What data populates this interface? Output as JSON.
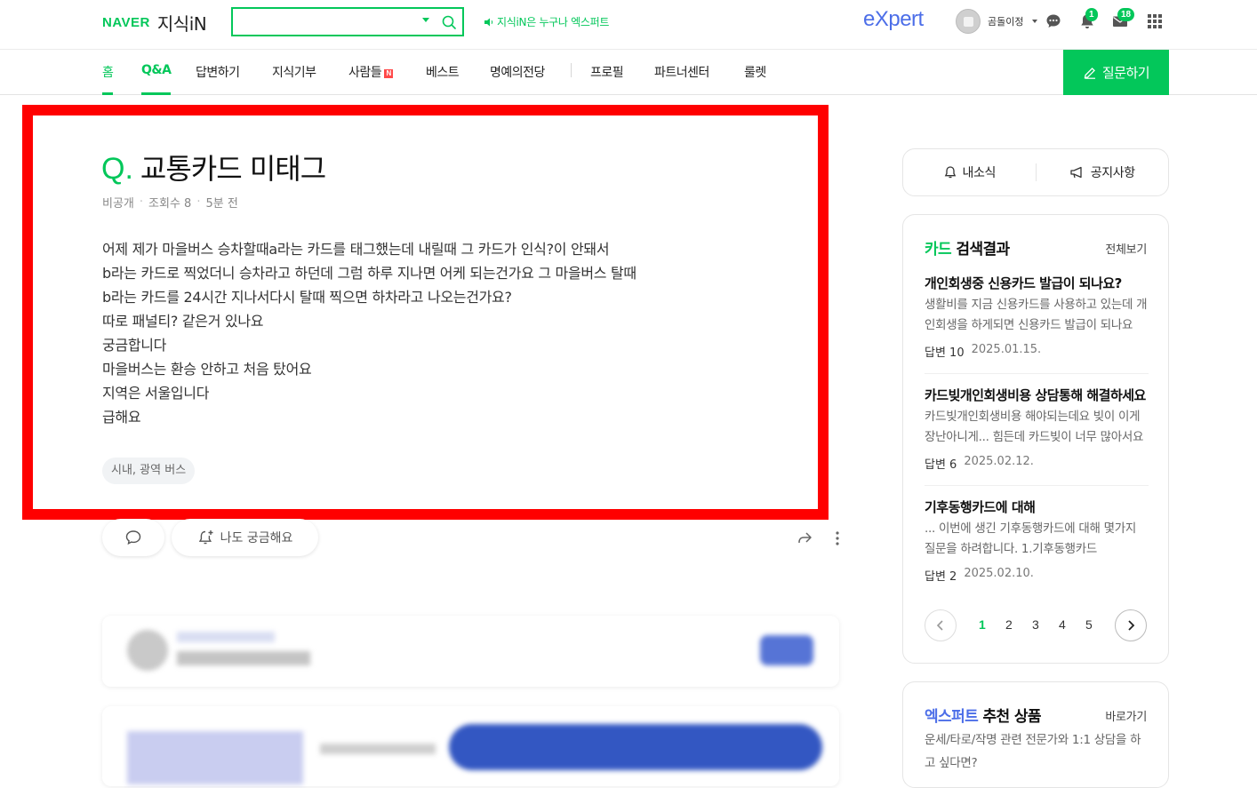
{
  "header": {
    "logo_naver": "NAVER",
    "logo_service": "지식iN",
    "search_value": "",
    "promo_text": "지식iN은 누구나 엑스퍼트",
    "expert_logo": "eXpert",
    "user_name": "곰돌이정",
    "notification_count": "1",
    "mail_count": "18"
  },
  "nav": {
    "items": [
      {
        "label": "홈"
      },
      {
        "label": "Q&A"
      },
      {
        "label": "답변하기"
      },
      {
        "label": "지식기부"
      },
      {
        "label": "사람들"
      },
      {
        "label": "베스트"
      },
      {
        "label": "명예의전당"
      },
      {
        "label": "프로필"
      },
      {
        "label": "파트너센터"
      },
      {
        "label": "룰렛"
      }
    ],
    "new_badge": "N",
    "ask_button": "질문하기"
  },
  "question": {
    "q_mark": "Q.",
    "title": "교통카드 미태그",
    "meta": {
      "author": "비공개",
      "views": "조회수 8",
      "time": "5분 전"
    },
    "body_lines": [
      "어제 제가 마을버스 승차할때a라는 카드를 태그했는데 내릴때 그 카드가 인식?이 안돼서",
      "b라는 카드로 찍었더니 승차라고 하던데 그럼 하루 지나면 어케 되는건가요 그 마을버스 탈때",
      "b라는 카드를 24시간 지나서다시 탈때 찍으면 하차라고 나오는건가요?",
      "따로 패널티? 같은거 있나요",
      "궁금합니다",
      "마을버스는 환승 안하고 처음 탔어요",
      "지역은 서울입니다",
      "급해요"
    ],
    "tag": "시내, 광역 버스",
    "curious_button": "나도 궁금해요"
  },
  "sidebar": {
    "notice": {
      "my_news": "내소식",
      "announcements": "공지사항"
    },
    "search_results": {
      "head_keyword": "카드",
      "head_rest": " 검색결과",
      "more": "전체보기",
      "items": [
        {
          "title": "개인회생중 신용카드 발급이 되나요?",
          "snippet": "생활비를 지금 신용카드를 사용하고 있는데 개인회생을 하게되면 신용카드 발급이 되나요",
          "answers": "답변 10",
          "date": "2025.01.15."
        },
        {
          "title": "카드빚개인회생비용 상담통해 해결하세요",
          "snippet": "카드빚개인회생비용 해야되는데요 빚이 이게 장난아니게... 힘든데 카드빚이 너무 많아서요",
          "answers": "답변 6",
          "date": "2025.02.12."
        },
        {
          "title": "기후동행카드에 대해",
          "snippet": "... 이번에 생긴 기후동행카드에 대해 몇가지 질문을 하려합니다. 1.기후동행카드",
          "answers": "답변 2",
          "date": "2025.02.10."
        }
      ],
      "pages": [
        "1",
        "2",
        "3",
        "4",
        "5"
      ]
    },
    "expert": {
      "head_brand": "엑스퍼트",
      "head_rest": " 추천 상품",
      "more": "바로가기",
      "text": "운세/타로/작명 관련 전문가와 1:1 상담을 하고 싶다면?"
    }
  },
  "colors": {
    "brand_green": "#03c75a",
    "expert_blue": "#4c6ee8",
    "highlight_red": "#ff0000"
  }
}
